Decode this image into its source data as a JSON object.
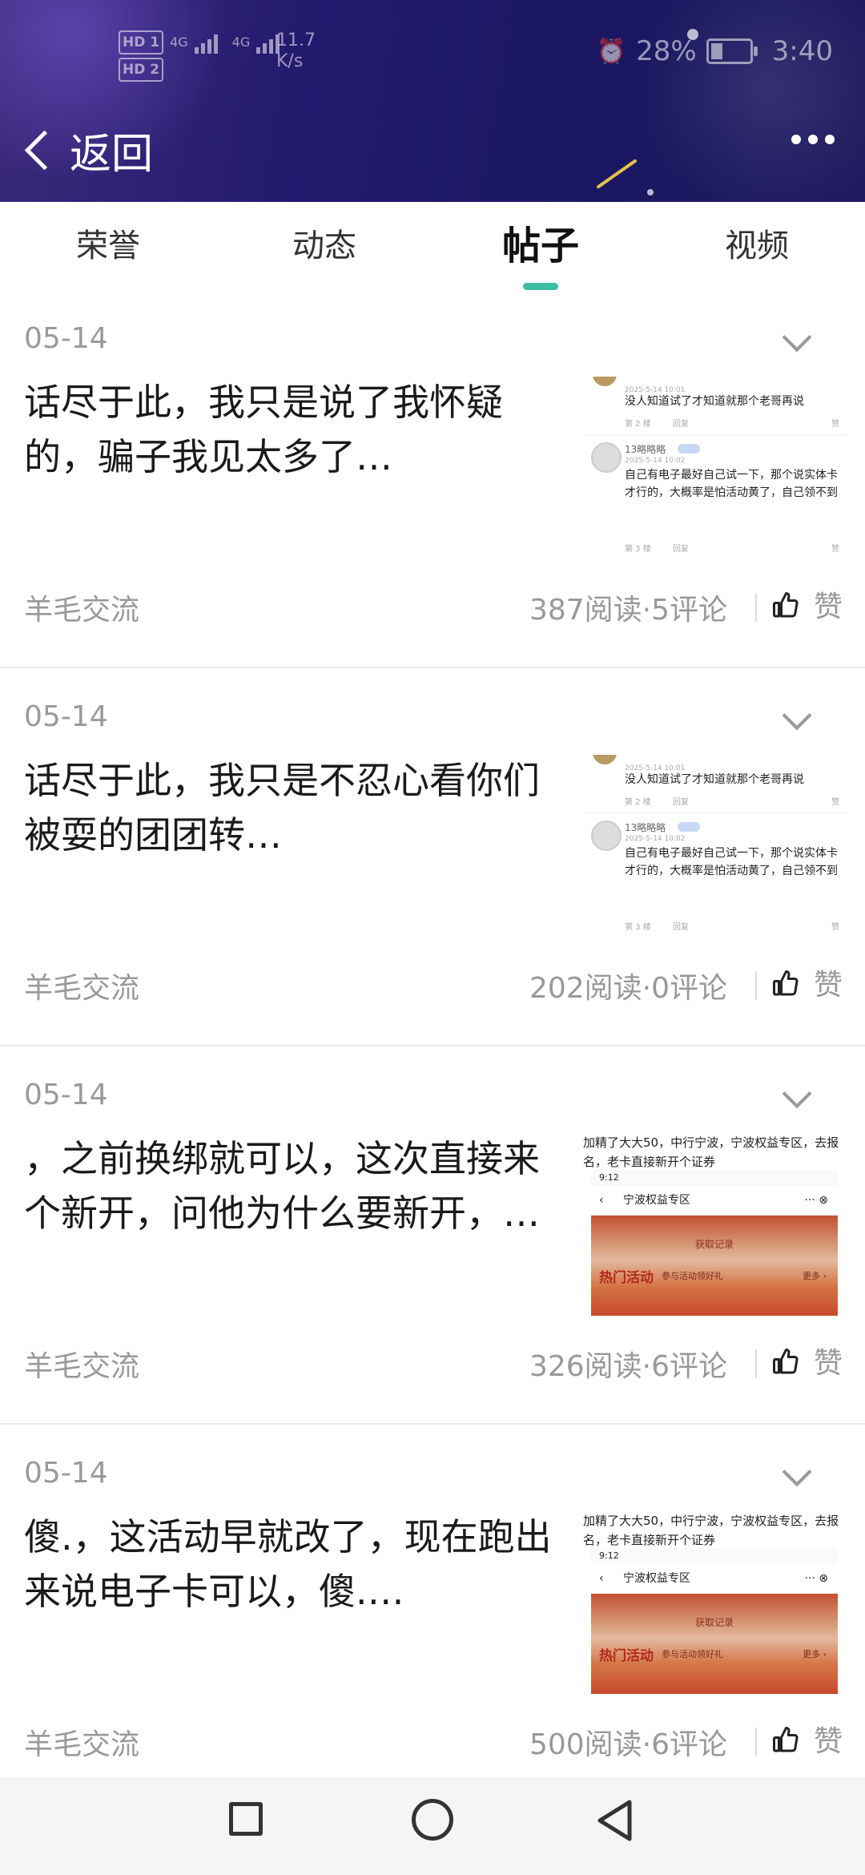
{
  "status": {
    "sim1": "HD 1",
    "sim2": "HD 2",
    "net1": "4G",
    "net2": "4G",
    "speed_value": "11.7",
    "speed_unit": "K/s",
    "battery": "28%",
    "battery_level": 0.28,
    "time": "3:40"
  },
  "header": {
    "back_label": "返回"
  },
  "tabs": [
    {
      "label": "荣誉",
      "active": false
    },
    {
      "label": "动态",
      "active": false
    },
    {
      "label": "帖子",
      "active": true
    },
    {
      "label": "视频",
      "active": false
    }
  ],
  "posts": [
    {
      "date": "05-14",
      "title": "话尽于此，我只是说了我怀疑的，骗子我见太多了…",
      "category": "羊毛交流",
      "stats": "387阅读·5评论",
      "like_label": "赞",
      "thumb": {
        "type": "comment",
        "c1_time": "2025-5-14 10:01",
        "c1_text": "没人知道试了才知道就那个老哥再说",
        "c1_floor": "第 2 楼",
        "c1_reply": "回复",
        "c1_like": "赞",
        "c2_user": "13略略略",
        "c2_time": "2025-5-14 10:02",
        "c2_text": "自己有电子最好自己试一下，那个说实体卡才行的，大概率是怕活动黄了，自己领不到",
        "c2_floor": "第 3 楼",
        "c2_reply": "回复",
        "c2_like": "赞"
      }
    },
    {
      "date": "05-14",
      "title": "话尽于此，我只是不忍心看你们被耍的团团转…",
      "category": "羊毛交流",
      "stats": "202阅读·0评论",
      "like_label": "赞",
      "thumb": {
        "type": "comment",
        "c1_time": "2025-5-14 10:01",
        "c1_text": "没人知道试了才知道就那个老哥再说",
        "c1_floor": "第 2 楼",
        "c1_reply": "回复",
        "c1_like": "赞",
        "c2_user": "13略略略",
        "c2_time": "2025-5-14 10:02",
        "c2_text": "自己有电子最好自己试一下，那个说实体卡才行的，大概率是怕活动黄了，自己领不到",
        "c2_floor": "第 3 楼",
        "c2_reply": "回复",
        "c2_like": "赞"
      }
    },
    {
      "date": "05-14",
      "title": "，之前换绑就可以，这次直接来个新开，问他为什么要新开，…",
      "category": "羊毛交流",
      "stats": "326阅读·6评论",
      "like_label": "赞",
      "thumb": {
        "type": "image",
        "caption": "加精了大大50，中行宁波，宁波权益专区，去报名，老卡直接新开个证券",
        "time": "9:12",
        "nav_title": "宁波权益专区",
        "record": "获取记录",
        "hot": "热门活动",
        "hot_sub": "参与活动领好礼",
        "more": "更多 ›"
      }
    },
    {
      "date": "05-14",
      "title": "傻.，这活动早就改了，现在跑出来说电子卡可以，傻.…",
      "category": "羊毛交流",
      "stats": "500阅读·6评论",
      "like_label": "赞",
      "thumb": {
        "type": "image",
        "caption": "加精了大大50，中行宁波，宁波权益专区，去报名，老卡直接新开个证券",
        "time": "9:12",
        "nav_title": "宁波权益专区",
        "record": "获取记录",
        "hot": "热门活动",
        "hot_sub": "参与活动领好礼",
        "more": "更多 ›"
      }
    }
  ],
  "colors": {
    "accent": "#3cbfa0",
    "header_bg": "#1f1a66",
    "muted_text": "#999999"
  },
  "icons": {
    "back": "chevron-left-icon",
    "more": "more-dots-icon",
    "fold": "chevron-down-icon",
    "like": "thumbs-up-icon",
    "nav_recent": "square-icon",
    "nav_home": "circle-icon",
    "nav_back": "triangle-back-icon"
  }
}
